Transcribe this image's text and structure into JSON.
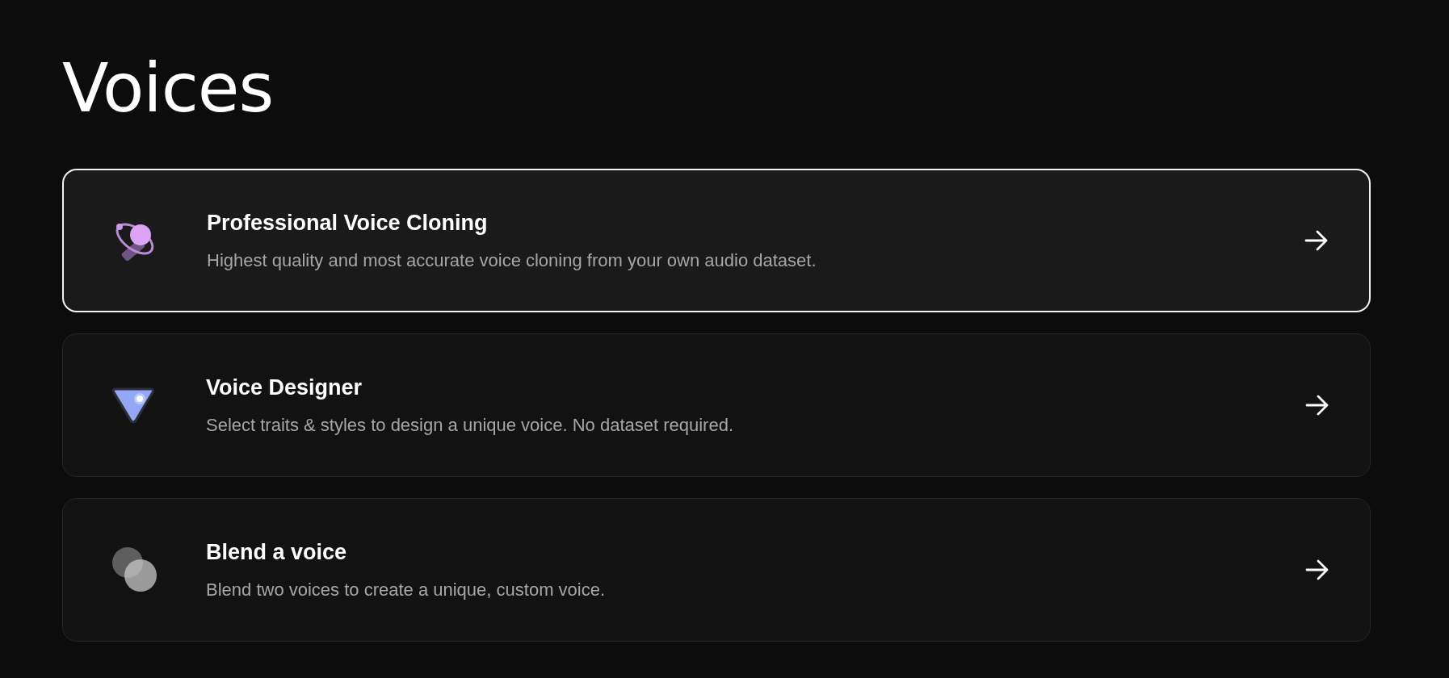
{
  "title": "Voices",
  "options": [
    {
      "kind": "cloning",
      "title": "Professional Voice Cloning",
      "description": "Highest quality and most accurate voice cloning from your own audio dataset.",
      "selected": true
    },
    {
      "kind": "designer",
      "title": "Voice Designer",
      "description": "Select traits & styles to design a unique voice. No dataset required.",
      "selected": false
    },
    {
      "kind": "blend",
      "title": "Blend a voice",
      "description": "Blend two voices to create a unique, custom voice.",
      "selected": false
    }
  ]
}
